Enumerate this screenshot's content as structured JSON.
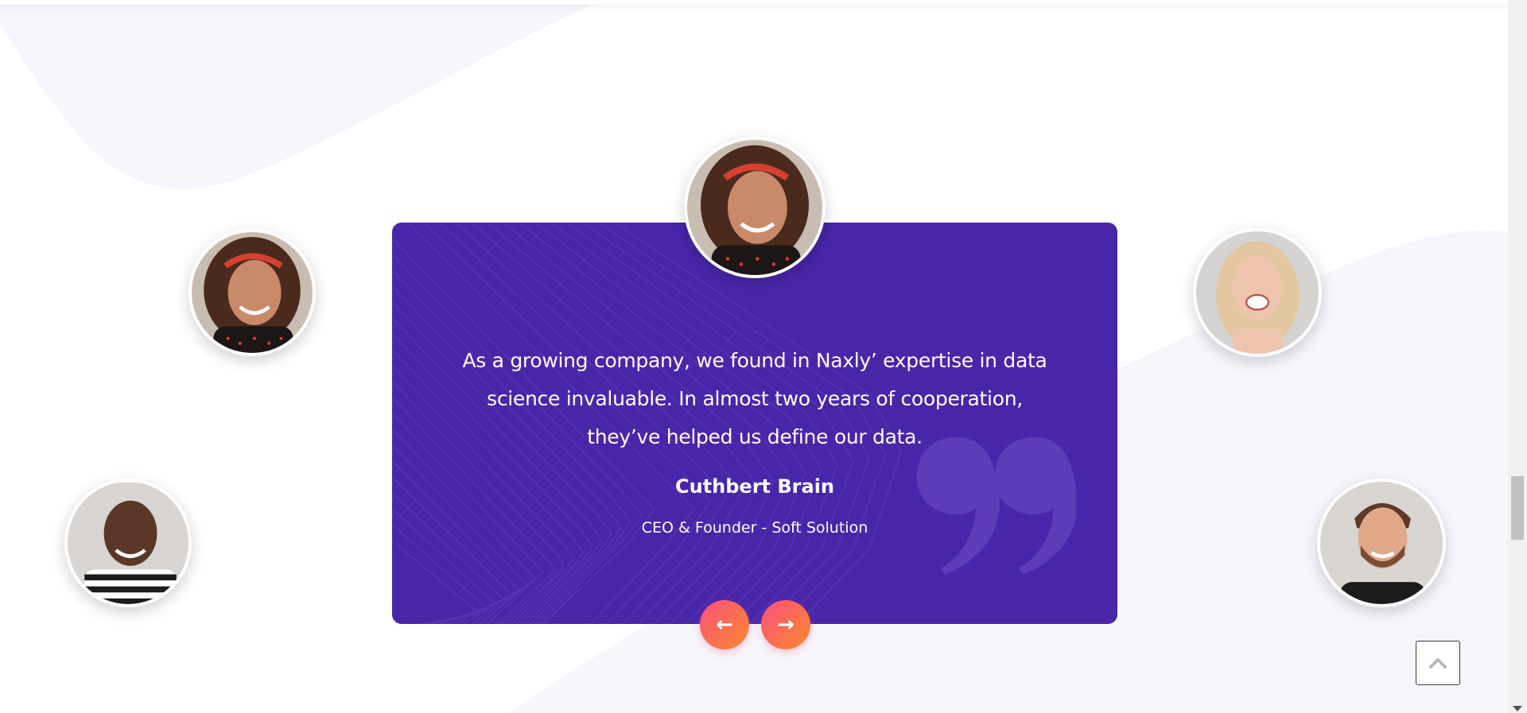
{
  "testimonial": {
    "quote": "As a growing company, we found in Naxly’ expertise in data science invaluable. In almost two years of cooperation, they’ve helped us define our data.",
    "author_name": "Cuthbert Brain",
    "author_role": "CEO & Founder - Soft Solution"
  },
  "navigation": {
    "prev_icon": "←",
    "next_icon": "→"
  },
  "icons": {
    "quote": "quote-icon",
    "back_to_top": "chevron-up-icon",
    "prev": "arrow-left-icon",
    "next": "arrow-right-icon"
  },
  "colors": {
    "card_background": "#4826a9",
    "button_gradient_start": "#fb4f7c",
    "button_gradient_end": "#f98a2d",
    "page_background": "#ffffff",
    "soft_shape": "#f7f6fd"
  },
  "avatars": [
    {
      "name": "avatar-active",
      "description": "woman with curly hair and red headband"
    },
    {
      "name": "avatar-left-top",
      "description": "woman with curly hair and red headband"
    },
    {
      "name": "avatar-left-bottom",
      "description": "smiling bald man in striped shirt"
    },
    {
      "name": "avatar-right-top",
      "description": "laughing blonde woman"
    },
    {
      "name": "avatar-right-bottom",
      "description": "smiling man with beard"
    }
  ]
}
